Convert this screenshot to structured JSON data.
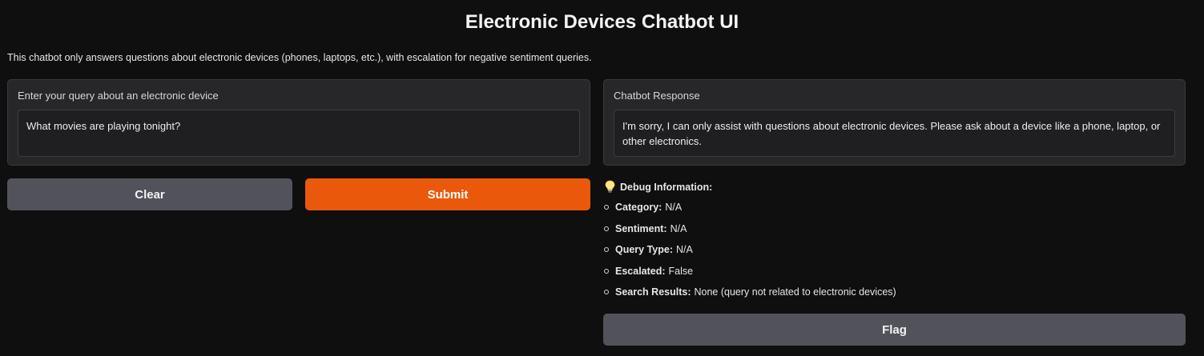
{
  "header": {
    "title": "Electronic Devices Chatbot UI",
    "description": "This chatbot only answers questions about electronic devices (phones, laptops, etc.), with escalation for negative sentiment queries."
  },
  "input_panel": {
    "label": "Enter your query about an electronic device",
    "value": "What movies are playing tonight?"
  },
  "response_panel": {
    "label": "Chatbot Response",
    "value": "I'm sorry, I can only assist with questions about electronic devices. Please ask about a device like a phone, laptop, or other electronics."
  },
  "buttons": {
    "clear": "Clear",
    "submit": "Submit",
    "flag": "Flag"
  },
  "debug": {
    "icon": "lightbulb-icon",
    "heading": "Debug Information:",
    "items": [
      {
        "key": "Category:",
        "value": "N/A"
      },
      {
        "key": "Sentiment:",
        "value": "N/A"
      },
      {
        "key": "Query Type:",
        "value": "N/A"
      },
      {
        "key": "Escalated:",
        "value": "False"
      },
      {
        "key": "Search Results:",
        "value": "None (query not related to electronic devices)"
      }
    ]
  },
  "colors": {
    "background": "#0f0f0f",
    "panel": "#27272a",
    "accent": "#ea580c",
    "secondary_button": "#52525b"
  }
}
